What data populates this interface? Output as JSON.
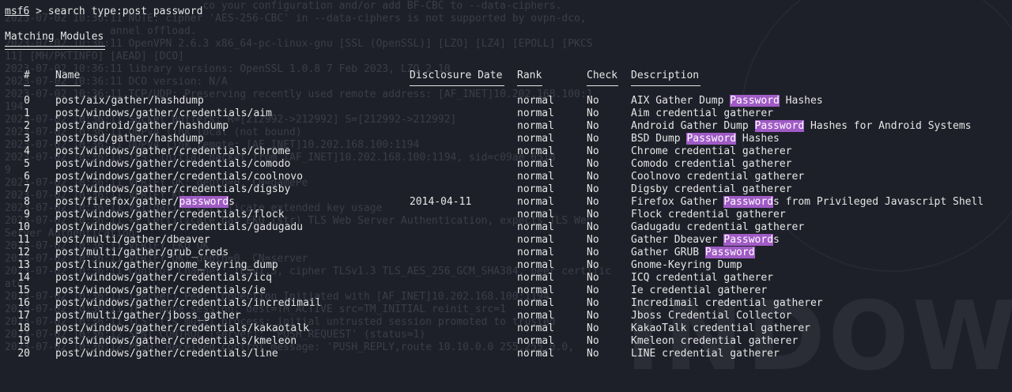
{
  "prompt": {
    "user": "msf6",
    "symbol": ">",
    "command": "search type:post password"
  },
  "section_title": "Matching Modules",
  "headers": {
    "num": "#",
    "name": "Name",
    "date": "Disclosure Date",
    "rank": "Rank",
    "check": "Check",
    "desc": "Description"
  },
  "highlight_color": "#a05bc5",
  "modules": [
    {
      "num": "0",
      "name": [
        "post/aix/gather/hashdump"
      ],
      "date": "",
      "rank": "normal",
      "check": "No",
      "desc": [
        "AIX Gather Dump ",
        {
          "hl": "Password"
        },
        " Hashes"
      ]
    },
    {
      "num": "1",
      "name": [
        "post/windows/gather/credentials/aim"
      ],
      "date": "",
      "rank": "normal",
      "check": "No",
      "desc": [
        "Aim credential gatherer"
      ]
    },
    {
      "num": "2",
      "name": [
        "post/android/gather/hashdump"
      ],
      "date": "",
      "rank": "normal",
      "check": "No",
      "desc": [
        "Android Gather Dump ",
        {
          "hl": "Password"
        },
        " Hashes for Android Systems"
      ]
    },
    {
      "num": "3",
      "name": [
        "post/bsd/gather/hashdump"
      ],
      "date": "",
      "rank": "normal",
      "check": "No",
      "desc": [
        "BSD Dump ",
        {
          "hl": "Password"
        },
        " Hashes"
      ]
    },
    {
      "num": "4",
      "name": [
        "post/windows/gather/credentials/chrome"
      ],
      "date": "",
      "rank": "normal",
      "check": "No",
      "desc": [
        "Chrome credential gatherer"
      ]
    },
    {
      "num": "5",
      "name": [
        "post/windows/gather/credentials/comodo"
      ],
      "date": "",
      "rank": "normal",
      "check": "No",
      "desc": [
        "Comodo credential gatherer"
      ]
    },
    {
      "num": "6",
      "name": [
        "post/windows/gather/credentials/coolnovo"
      ],
      "date": "",
      "rank": "normal",
      "check": "No",
      "desc": [
        "Coolnovo credential gatherer"
      ]
    },
    {
      "num": "7",
      "name": [
        "post/windows/gather/credentials/digsby"
      ],
      "date": "",
      "rank": "normal",
      "check": "No",
      "desc": [
        "Digsby credential gatherer"
      ]
    },
    {
      "num": "8",
      "name": [
        "post/firefox/gather/",
        {
          "hl": "password"
        },
        "s"
      ],
      "date": "2014-04-11",
      "rank": "normal",
      "check": "No",
      "desc": [
        "Firefox Gather ",
        {
          "hl": "Password"
        },
        "s from Privileged Javascript Shell"
      ]
    },
    {
      "num": "9",
      "name": [
        "post/windows/gather/credentials/flock"
      ],
      "date": "",
      "rank": "normal",
      "check": "No",
      "desc": [
        "Flock credential gatherer"
      ]
    },
    {
      "num": "10",
      "name": [
        "post/windows/gather/credentials/gadugadu"
      ],
      "date": "",
      "rank": "normal",
      "check": "No",
      "desc": [
        "Gadugadu credential gatherer"
      ]
    },
    {
      "num": "11",
      "name": [
        "post/multi/gather/dbeaver"
      ],
      "date": "",
      "rank": "normal",
      "check": "No",
      "desc": [
        "Gather Dbeaver ",
        {
          "hl": "Password"
        },
        "s"
      ]
    },
    {
      "num": "12",
      "name": [
        "post/multi/gather/grub_creds"
      ],
      "date": "",
      "rank": "normal",
      "check": "No",
      "desc": [
        "Gather GRUB ",
        {
          "hl": "Password"
        }
      ]
    },
    {
      "num": "13",
      "name": [
        "post/linux/gather/gnome_keyring_dump"
      ],
      "date": "",
      "rank": "normal",
      "check": "No",
      "desc": [
        "Gnome-Keyring Dump"
      ]
    },
    {
      "num": "14",
      "name": [
        "post/windows/gather/credentials/icq"
      ],
      "date": "",
      "rank": "normal",
      "check": "No",
      "desc": [
        "ICQ credential gatherer"
      ]
    },
    {
      "num": "15",
      "name": [
        "post/windows/gather/credentials/ie"
      ],
      "date": "",
      "rank": "normal",
      "check": "No",
      "desc": [
        "Ie credential gatherer"
      ]
    },
    {
      "num": "16",
      "name": [
        "post/windows/gather/credentials/incredimail"
      ],
      "date": "",
      "rank": "normal",
      "check": "No",
      "desc": [
        "Incredimail credential gatherer"
      ]
    },
    {
      "num": "17",
      "name": [
        "post/multi/gather/jboss_gather"
      ],
      "date": "",
      "rank": "normal",
      "check": "No",
      "desc": [
        "Jboss Credential Collector"
      ]
    },
    {
      "num": "18",
      "name": [
        "post/windows/gather/credentials/kakaotalk"
      ],
      "date": "",
      "rank": "normal",
      "check": "No",
      "desc": [
        "KakaoTalk credential gatherer"
      ]
    },
    {
      "num": "19",
      "name": [
        "post/windows/gather/credentials/kmeleon"
      ],
      "date": "",
      "rank": "normal",
      "check": "No",
      "desc": [
        "Kmeleon credential gatherer"
      ]
    },
    {
      "num": "20",
      "name": [
        "post/windows/gather/credentials/line"
      ],
      "date": "",
      "rank": "normal",
      "check": "No",
      "desc": [
        "LINE credential gatherer"
      ]
    }
  ],
  "background_log": [
    "                                co your configuration and/or add BF-CBC to --data-ciphers.",
    "2023-07-02 10:36:11 NOTE: cipher 'AES-256-CBC' in --data-ciphers is not supported by ovpn-dco,",
    "                 annel offload.",
    "2023-07-02 10:36:11 OpenVPN 2.6.3 x86_64-pc-linux-gnu [SSL (OpenSSL)] [LZO] [LZ4] [EPOLL] [PKCS",
    "11] [MH/PKTINFO] [AEAD] [DCO]",
    "2023-07-02 10:36:11 library versions: OpenSSL 1.0.8 7 Feb 2023, LZO 2.10",
    "2023-07-02 10:36:11 DCO version: N/A",
    "2023-07-02 10:36:11 TCP/UDP: Preserving recently used remote address: [AF_INET]10.202.168.100:1",
    "194",
    "2023-07-02 10:36:11 Socket Buffers: R=[212992->212992] S=[212992->212992]",
    "2023-07-02 10:36:11 UDPv4 link local (not bound)",
    "2023-07-02 10:36:11 UDPv4 link remote: [AF_INET]10.202.168.100:1194",
    "2023-07-02 10:36:11 TLS: Initial packet from [AF_INET]10.202.168.100:1194, sid=c09ae 6518",
    "9",
    "2023-07-02 10:36:11 VERIFY OK: depth=0, CN=gamePe",
    "2023-07-02 10:36:11 VERIFY KU OK",
    "2023-07-02 10:36:11 Validating certificate extended key usage",
    "2023-07-02 10:36:11 ++ Certificate has EKU (str) TLS Web Server Authentication, expects TLS Web",
    "Server Authentication",
    "2023-07-02 10:36:11 VERIFY EKU OK",
    "2023-07-02 10:36:11 VERIFY OK: depth=0, CN=server",
    "2023-07-02 10:36:11 Control Channel: TLSv1.3, cipher TLSv1.3 TLS_AES_256_GCM_SHA384, peer certific",
    "ate",
    "2023-07-02 10:36:11 [server] Peer Connection Initiated with [AF_INET]10.202.168.100:1194",
    "2023-07-02 10:36:11 TLS: move_session: dest=TM_ACTIVE src=TM_INITIAL reinit_src=1",
    "2023-07-02 10:36:11 TLS: tls_multi_process: initial untrusted session promoted to trusted",
    "2023-07-02 10:36:12 SENT CONTROL [server]: 'PUSH_REQUEST' (status=1)",
    "2023-07-02 10:36:12 PUSH: Received control message: 'PUSH_REPLY,route 10.10.0.0 255.255.0.0,"
  ]
}
